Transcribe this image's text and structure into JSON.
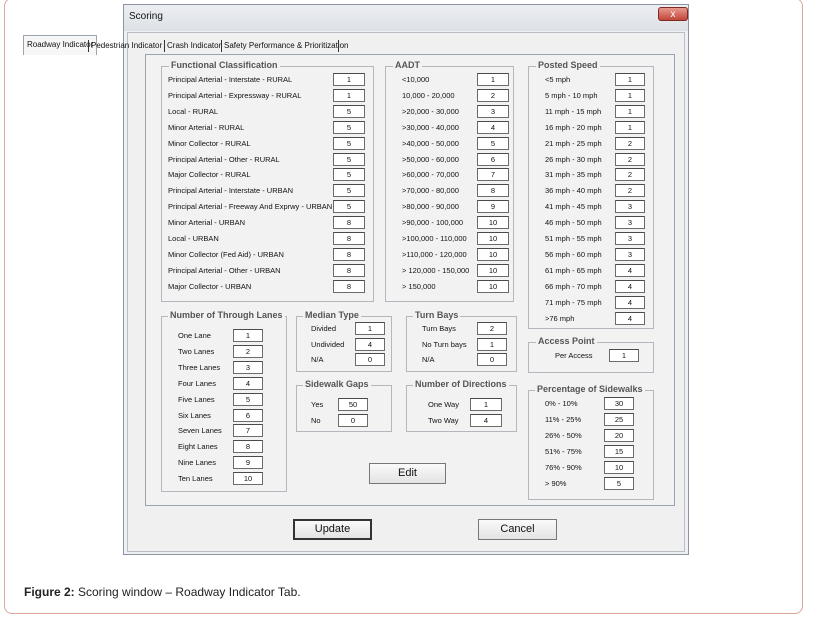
{
  "window": {
    "title": "Scoring",
    "close_label": "x"
  },
  "tabs": [
    "Roadway Indicator",
    "Pedestrian Indicator",
    "Crash Indicator",
    "Safety Performance & Prioritization"
  ],
  "functional": {
    "title": "Functional Classification",
    "items": [
      {
        "label": "Principal Arterial - Interstate - RURAL",
        "value": "1"
      },
      {
        "label": "Principal Arterial - Expressway - RURAL",
        "value": "1"
      },
      {
        "label": "Local - RURAL",
        "value": "5"
      },
      {
        "label": "Minor Arterial - RURAL",
        "value": "5"
      },
      {
        "label": "Minor Collector - RURAL",
        "value": "5"
      },
      {
        "label": "Principal Arterial - Other - RURAL",
        "value": "5"
      },
      {
        "label": "Major Collector - RURAL",
        "value": "5"
      },
      {
        "label": "Principal Arterial - Interstate - URBAN",
        "value": "5"
      },
      {
        "label": "Principal Arterial - Freeway And Exprwy - URBAN",
        "value": "5"
      },
      {
        "label": "Minor Arterial - URBAN",
        "value": "8"
      },
      {
        "label": "Local - URBAN",
        "value": "8"
      },
      {
        "label": "Minor Collector (Fed Aid) - URBAN",
        "value": "8"
      },
      {
        "label": "Principal Arterial - Other - URBAN",
        "value": "8"
      },
      {
        "label": "Major Collector - URBAN",
        "value": "8"
      }
    ]
  },
  "aadt": {
    "title": "AADT",
    "items": [
      {
        "label": "<10,000",
        "value": "1"
      },
      {
        "label": "10,000 - 20,000",
        "value": "2"
      },
      {
        "label": ">20,000 - 30,000",
        "value": "3"
      },
      {
        "label": ">30,000 - 40,000",
        "value": "4"
      },
      {
        "label": ">40,000 - 50,000",
        "value": "5"
      },
      {
        "label": ">50,000 - 60,000",
        "value": "6"
      },
      {
        "label": ">60,000 - 70,000",
        "value": "7"
      },
      {
        "label": ">70,000 - 80,000",
        "value": "8"
      },
      {
        "label": ">80,000 - 90,000",
        "value": "9"
      },
      {
        "label": ">90,000 - 100,000",
        "value": "10"
      },
      {
        "label": ">100,000 - 110,000",
        "value": "10"
      },
      {
        "label": ">110,000 - 120,000",
        "value": "10"
      },
      {
        "label": "> 120,000 - 150,000",
        "value": "10"
      },
      {
        "label": "> 150,000",
        "value": "10"
      }
    ]
  },
  "speed": {
    "title": "Posted Speed",
    "items": [
      {
        "label": "<5 mph",
        "value": "1"
      },
      {
        "label": "5 mph - 10 mph",
        "value": "1"
      },
      {
        "label": "11 mph - 15 mph",
        "value": "1"
      },
      {
        "label": "16 mph - 20 mph",
        "value": "1"
      },
      {
        "label": "21 mph - 25 mph",
        "value": "2"
      },
      {
        "label": "26 mph - 30 mph",
        "value": "2"
      },
      {
        "label": "31 mph - 35 mph",
        "value": "2"
      },
      {
        "label": "36 mph - 40 mph",
        "value": "2"
      },
      {
        "label": "41 mph - 45 mph",
        "value": "3"
      },
      {
        "label": "46 mph - 50 mph",
        "value": "3"
      },
      {
        "label": "51 mph - 55 mph",
        "value": "3"
      },
      {
        "label": "56 mph - 60 mph",
        "value": "3"
      },
      {
        "label": "61 mph - 65 mph",
        "value": "4"
      },
      {
        "label": "66 mph - 70 mph",
        "value": "4"
      },
      {
        "label": "71 mph - 75 mph",
        "value": "4"
      },
      {
        "label": ">76 mph",
        "value": "4"
      }
    ]
  },
  "lanes": {
    "title": "Number of Through Lanes",
    "items": [
      {
        "label": "One Lane",
        "value": "1"
      },
      {
        "label": "Two Lanes",
        "value": "2"
      },
      {
        "label": "Three Lanes",
        "value": "3"
      },
      {
        "label": "Four Lanes",
        "value": "4"
      },
      {
        "label": "Five Lanes",
        "value": "5"
      },
      {
        "label": "Six Lanes",
        "value": "6"
      },
      {
        "label": "Seven Lanes",
        "value": "7"
      },
      {
        "label": "Eight Lanes",
        "value": "8"
      },
      {
        "label": "Nine Lanes",
        "value": "9"
      },
      {
        "label": "Ten Lanes",
        "value": "10"
      }
    ]
  },
  "median": {
    "title": "Median Type",
    "items": [
      {
        "label": "Divided",
        "value": "1"
      },
      {
        "label": "Undivided",
        "value": "4"
      },
      {
        "label": "N/A",
        "value": "0"
      }
    ]
  },
  "turn": {
    "title": "Turn Bays",
    "items": [
      {
        "label": "Turn Bays",
        "value": "2"
      },
      {
        "label": "No Turn bays",
        "value": "1"
      },
      {
        "label": "N/A",
        "value": "0"
      }
    ]
  },
  "sidewalk_gaps": {
    "title": "Sidewalk Gaps",
    "items": [
      {
        "label": "Yes",
        "value": "50"
      },
      {
        "label": "No",
        "value": "0"
      }
    ]
  },
  "directions": {
    "title": "Number of Directions",
    "items": [
      {
        "label": "One Way",
        "value": "1"
      },
      {
        "label": "Two Way",
        "value": "4"
      }
    ]
  },
  "access": {
    "title": "Access Point",
    "items": [
      {
        "label": "Per Access",
        "value": "1"
      }
    ]
  },
  "sidewalk_pct": {
    "title": "Percentage of Sidewalks",
    "items": [
      {
        "label": "0% - 10%",
        "value": "30"
      },
      {
        "label": "11% - 25%",
        "value": "25"
      },
      {
        "label": "26% - 50%",
        "value": "20"
      },
      {
        "label": "51% - 75%",
        "value": "15"
      },
      {
        "label": "76% - 90%",
        "value": "10"
      },
      {
        "label": "> 90%",
        "value": "5"
      }
    ]
  },
  "buttons": {
    "edit": "Edit",
    "update": "Update",
    "cancel": "Cancel"
  },
  "caption": {
    "label": "Figure 2:",
    "text": " Scoring window – Roadway Indicator Tab."
  }
}
